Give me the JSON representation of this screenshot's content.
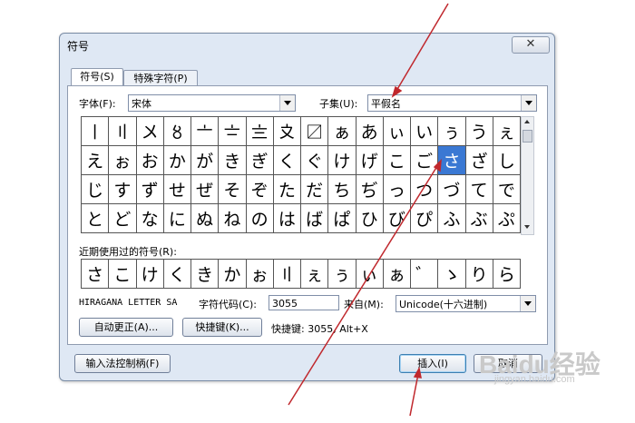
{
  "window": {
    "title": "符号",
    "close_glyph": "✕"
  },
  "tabs": [
    {
      "label": "符号(S)"
    },
    {
      "label": "特殊字符(P)"
    }
  ],
  "font": {
    "label": "字体(F):",
    "value": "宋体"
  },
  "subset": {
    "label": "子集(U):",
    "value": "平假名"
  },
  "symbol_grid": [
    [
      "〡",
      "〢",
      "〤",
      "〥",
      "〦",
      "〧",
      "〨",
      "〩",
      "〼",
      "ぁ",
      "あ",
      "ぃ",
      "い",
      "ぅ",
      "う",
      "ぇ"
    ],
    [
      "え",
      "ぉ",
      "お",
      "か",
      "が",
      "き",
      "ぎ",
      "く",
      "ぐ",
      "け",
      "げ",
      "こ",
      "ご",
      "さ",
      "ざ",
      "し"
    ],
    [
      "じ",
      "す",
      "ず",
      "せ",
      "ぜ",
      "そ",
      "ぞ",
      "た",
      "だ",
      "ち",
      "ぢ",
      "っ",
      "つ",
      "づ",
      "て",
      "で"
    ],
    [
      "と",
      "ど",
      "な",
      "に",
      "ぬ",
      "ね",
      "の",
      "は",
      "ば",
      "ぱ",
      "ひ",
      "び",
      "ぴ",
      "ふ",
      "ぶ",
      "ぷ"
    ]
  ],
  "recent": {
    "label": "近期使用过的符号(R):",
    "symbols": [
      "さ",
      "こ",
      "け",
      "く",
      "き",
      "か",
      "ぉ",
      "〢",
      "ぇ",
      "ぅ",
      "ぃ",
      "ぁ",
      "゛",
      "ゝ",
      "り",
      "ら"
    ]
  },
  "char_name": "HIRAGANA LETTER SA",
  "char_code": {
    "label": "字符代码(C):",
    "value": "3055"
  },
  "from": {
    "label": "来自(M):",
    "value": "Unicode(十六进制)"
  },
  "buttons": {
    "autocorrect": "自动更正(A)...",
    "shortcut": "快捷键(K)...",
    "ime": "输入法控制柄(F)",
    "insert": "插入(I)",
    "cancel": "取消"
  },
  "shortcut_text": "快捷键: 3055, Alt+X",
  "watermark": {
    "brand": "Baidu经验",
    "url": "jingyan.baidu.com"
  },
  "colors": {
    "selection": "#3a78d3",
    "annotation_arrow": "#c0282d",
    "dialog_bg": "#dfe8f4"
  }
}
